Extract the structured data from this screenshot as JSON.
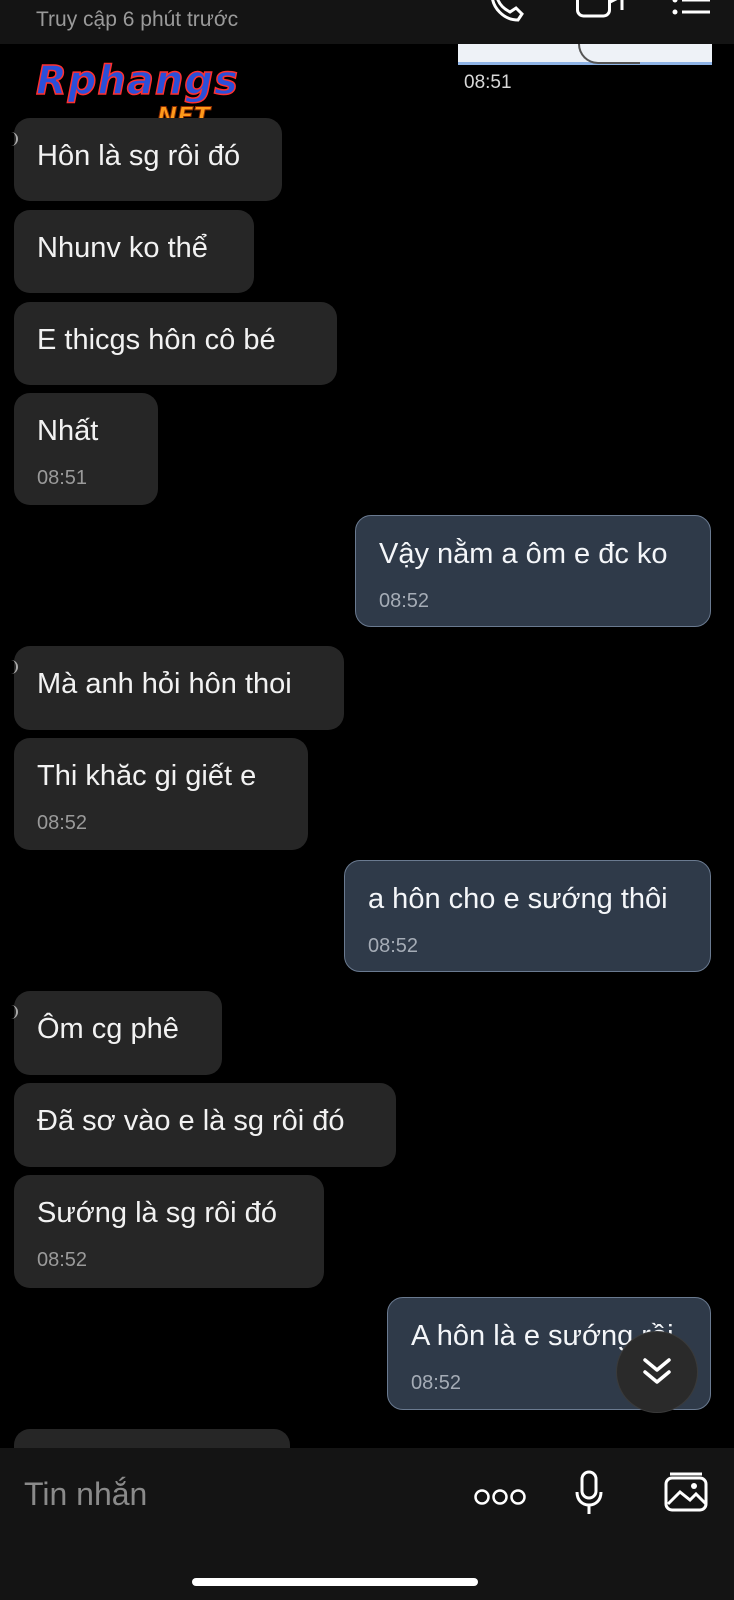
{
  "header": {
    "status": "Truy cập 6 phút trước",
    "icons": [
      "phone-icon",
      "video-call-icon",
      "menu-icon"
    ]
  },
  "watermark": {
    "brand": "Rphangs",
    "suffix": ".NET"
  },
  "image_message": {
    "time": "08:51"
  },
  "messages": [
    {
      "dir": "in",
      "text": "Hôn là sg rôi đó"
    },
    {
      "dir": "in",
      "text": "Nhunv ko thể"
    },
    {
      "dir": "in",
      "text": "E thicgs  hôn cô bé"
    },
    {
      "dir": "in",
      "text": "Nhất",
      "time": "08:51"
    },
    {
      "dir": "out",
      "text": "Vậy nằm a ôm e đc ko",
      "time": "08:52"
    },
    {
      "dir": "in",
      "text": "Mà anh hỏi hôn thoi"
    },
    {
      "dir": "in",
      "text": "Thi khăc gi giết e",
      "time": "08:52"
    },
    {
      "dir": "out",
      "text": "a hôn cho e sướng thôi",
      "time": "08:52"
    },
    {
      "dir": "in",
      "text": "Ôm cg phê"
    },
    {
      "dir": "in",
      "text": "Đã sơ vào e là sg rôi đó"
    },
    {
      "dir": "in",
      "text": "Sướng là sg rôi đó",
      "time": "08:52"
    },
    {
      "dir": "out",
      "text": "A hôn là e sướng rồi",
      "time": "08:52"
    }
  ],
  "composer": {
    "placeholder": "Tin nhắn",
    "icons": [
      "more-options-icon",
      "microphone-icon",
      "image-icon"
    ]
  }
}
